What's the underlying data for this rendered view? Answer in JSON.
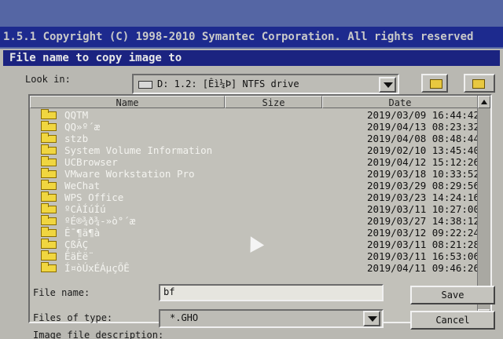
{
  "banner": {
    "text": "1.5.1   Copyright (C) 1998-2010 Symantec Corporation. All rights reserved"
  },
  "dialog": {
    "title": "File name to copy image to",
    "look_in": {
      "label": "Look in:",
      "value": "D: 1.2: [Êì¼Þ] NTFS drive"
    },
    "columns": {
      "name": "Name",
      "size": "Size",
      "date": "Date"
    },
    "files": [
      {
        "name": "QQTM",
        "size": "",
        "date": "2019/03/09 16:44:42"
      },
      {
        "name": "QQ»º´æ",
        "size": "",
        "date": "2019/04/13 08:23:32"
      },
      {
        "name": "stzb",
        "size": "",
        "date": "2019/04/08 08:48:44"
      },
      {
        "name": "System Volume Information",
        "size": "",
        "date": "2019/02/10 13:45:40"
      },
      {
        "name": "UCBrowser",
        "size": "",
        "date": "2019/04/12 15:12:26"
      },
      {
        "name": "VMware Workstation Pro",
        "size": "",
        "date": "2019/03/18 10:33:52"
      },
      {
        "name": "WeChat",
        "size": "",
        "date": "2019/03/29 08:29:56"
      },
      {
        "name": "WPS Office",
        "size": "",
        "date": "2019/03/23 14:24:16"
      },
      {
        "name": "ºCÀÍúÍú",
        "size": "",
        "date": "2019/03/11 10:27:00"
      },
      {
        "name": "ºÉ®¾ð¾-»ò°´æ",
        "size": "",
        "date": "2019/03/27 14:38:12"
      },
      {
        "name": "Ê¯¶ä¶à",
        "size": "",
        "date": "2019/03/12 09:22:24"
      },
      {
        "name": "ÇßÂÇ",
        "size": "",
        "date": "2019/03/11 08:21:28"
      },
      {
        "name": "ÊäÈë¨",
        "size": "",
        "date": "2019/03/11 16:53:06"
      },
      {
        "name": "Í¤òÚxÉÁµçÕÊ",
        "size": "",
        "date": "2019/04/11 09:46:26"
      }
    ],
    "file_name": {
      "label": "File name:",
      "value": "bf"
    },
    "files_of_type": {
      "label": "Files of type:",
      "value": "*.GHO"
    },
    "image_description": {
      "label": "Image file description:"
    },
    "buttons": {
      "save": "Save",
      "cancel": "Cancel"
    },
    "icons": {
      "up": "folder-up-icon",
      "new": "new-folder-icon"
    }
  }
}
